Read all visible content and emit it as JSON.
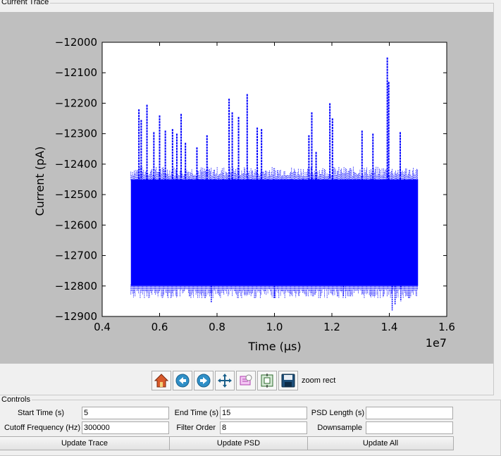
{
  "trace_group": {
    "title": "Current Trace"
  },
  "chart_data": {
    "type": "scatter",
    "title": "",
    "xlabel": "Time (μs)",
    "ylabel": "Current (pA)",
    "xlim": [
      0.4,
      1.6
    ],
    "ylim": [
      -12900,
      -12000
    ],
    "x_scale_label": "1e7",
    "x_ticks": [
      "0.4",
      "0.6",
      "0.8",
      "1.0",
      "1.2",
      "1.4",
      "1.6"
    ],
    "y_ticks": [
      "−12000",
      "−12100",
      "−12200",
      "−12300",
      "−12400",
      "−12500",
      "−12600",
      "−12700",
      "−12800",
      "−12900"
    ],
    "band": {
      "x_start": 0.5,
      "x_end": 1.5,
      "y_top": -12450,
      "y_bottom": -12800
    },
    "spikes": [
      {
        "x": 0.528,
        "y": -12220
      },
      {
        "x": 0.536,
        "y": -12255
      },
      {
        "x": 0.556,
        "y": -12205
      },
      {
        "x": 0.58,
        "y": -12295
      },
      {
        "x": 0.6,
        "y": -12240
      },
      {
        "x": 0.62,
        "y": -12290
      },
      {
        "x": 0.645,
        "y": -12285
      },
      {
        "x": 0.66,
        "y": -12300
      },
      {
        "x": 0.675,
        "y": -12235
      },
      {
        "x": 0.69,
        "y": -12330
      },
      {
        "x": 0.73,
        "y": -12345
      },
      {
        "x": 0.765,
        "y": -12305
      },
      {
        "x": 0.842,
        "y": -12185
      },
      {
        "x": 0.853,
        "y": -12230
      },
      {
        "x": 0.875,
        "y": -12245
      },
      {
        "x": 0.905,
        "y": -12170
      },
      {
        "x": 0.94,
        "y": -12280
      },
      {
        "x": 0.955,
        "y": -12285
      },
      {
        "x": 1.12,
        "y": -12305
      },
      {
        "x": 1.13,
        "y": -12230
      },
      {
        "x": 1.145,
        "y": -12360
      },
      {
        "x": 1.193,
        "y": -12200
      },
      {
        "x": 1.202,
        "y": -12250
      },
      {
        "x": 1.305,
        "y": -12290
      },
      {
        "x": 1.343,
        "y": -12300
      },
      {
        "x": 1.393,
        "y": -12050
      },
      {
        "x": 1.398,
        "y": -12130
      },
      {
        "x": 1.438,
        "y": -12295
      }
    ],
    "dips": [
      {
        "x": 0.78,
        "y": -12855
      },
      {
        "x": 1.0,
        "y": -12840
      },
      {
        "x": 1.24,
        "y": -12835
      },
      {
        "x": 1.41,
        "y": -12880
      },
      {
        "x": 1.42,
        "y": -12860
      },
      {
        "x": 1.44,
        "y": -12850
      }
    ],
    "color": "#0000ff"
  },
  "toolbar": {
    "buttons": [
      {
        "name": "home-icon",
        "label": "Home"
      },
      {
        "name": "back-arrow-icon",
        "label": "Back"
      },
      {
        "name": "forward-arrow-icon",
        "label": "Forward"
      },
      {
        "name": "pan-icon",
        "label": "Pan"
      },
      {
        "name": "zoom-rect-icon",
        "label": "Zoom"
      },
      {
        "name": "subplots-icon",
        "label": "Subplots"
      },
      {
        "name": "save-icon",
        "label": "Save"
      }
    ],
    "status": "zoom rect"
  },
  "controls": {
    "title": "Controls",
    "start_time_label": "Start Time (s)",
    "start_time_value": "5",
    "end_time_label": "End Time (s)",
    "end_time_value": "15",
    "psd_length_label": "PSD Length (s)",
    "psd_length_value": "",
    "cutoff_label": "Cutoff Frequency (Hz)",
    "cutoff_value": "300000",
    "filter_order_label": "Filter Order",
    "filter_order_value": "8",
    "downsample_label": "Downsample",
    "downsample_value": "",
    "update_trace": "Update Trace",
    "update_psd": "Update PSD",
    "update_all": "Update All"
  }
}
